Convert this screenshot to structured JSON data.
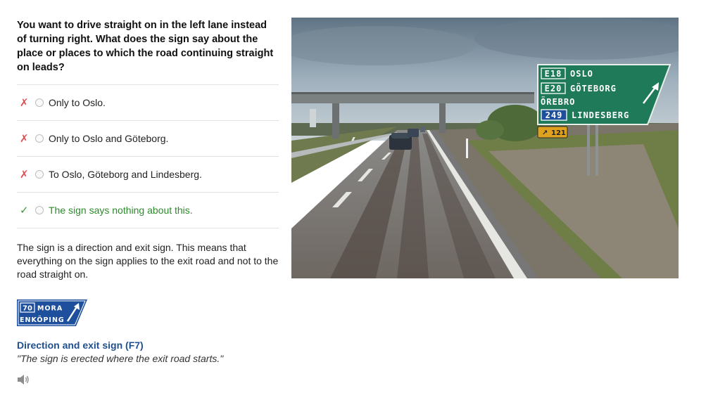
{
  "question": "You want to drive straight on in the left lane instead of turning right. What does the sign say about the place or places to which the road continuing straight on leads?",
  "answers": [
    {
      "label": "Only to Oslo.",
      "mark": "✗",
      "status": "wrong"
    },
    {
      "label": "Only to Oslo and Göteborg.",
      "mark": "✗",
      "status": "wrong"
    },
    {
      "label": "To Oslo, Göteborg and Lindesberg.",
      "mark": "✗",
      "status": "wrong"
    },
    {
      "label": "The sign says nothing about this.",
      "mark": "✓",
      "status": "correct"
    }
  ],
  "explanation": "The sign is a direction and exit sign. This means that everything on the sign applies to the exit road and not to the road straight on.",
  "example_sign": {
    "route": "70",
    "place1": "MORA",
    "place2": "ENKÖPING"
  },
  "sign_description": {
    "title": "Direction and exit sign (F7)",
    "quote": "\"The sign is erected where the exit road starts.\""
  },
  "photo_sign": {
    "rows": [
      {
        "route": "E18",
        "place": "OSLO"
      },
      {
        "route": "E20",
        "place": "GÖTEBORG"
      },
      {
        "route": "",
        "place": "ÖREBRO"
      },
      {
        "route": "249",
        "place": "LINDESBERG"
      }
    ],
    "exit_number": "121"
  },
  "colors": {
    "wrong_mark": "#e05050",
    "correct_mark": "#3a9a3a",
    "correct_text": "#2d8a2d",
    "link_blue": "#1f4f8f",
    "sign_green": "#1f7a5a",
    "sign_blue": "#1d4f9c"
  },
  "icons": {
    "speaker": "speaker-icon"
  }
}
